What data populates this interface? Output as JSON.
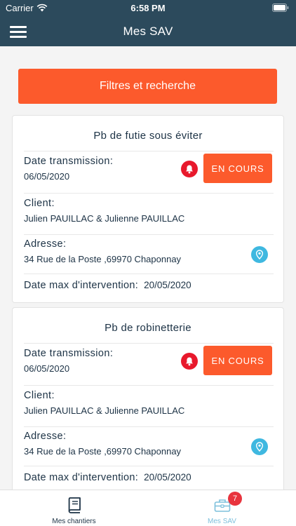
{
  "status_bar": {
    "carrier": "Carrier",
    "time": "6:58 PM"
  },
  "header": {
    "title": "Mes SAV"
  },
  "filter_button_label": "Filtres et recherche",
  "cards": [
    {
      "title": "Pb de futie sous éviter",
      "transmission_label": "Date transmission:",
      "transmission_date": "06/05/2020",
      "status": "EN COURS",
      "client_label": "Client:",
      "client": "Julien PAUILLAC & Julienne PAUILLAC",
      "address_label": "Adresse:",
      "address": "34 Rue de la Poste ,69970 Chaponnay",
      "date_max_label": "Date max d'intervention:",
      "date_max": "20/05/2020"
    },
    {
      "title": "Pb de robinetterie",
      "transmission_label": "Date transmission:",
      "transmission_date": "06/05/2020",
      "status": "EN COURS",
      "client_label": "Client:",
      "client": "Julien PAUILLAC & Julienne PAUILLAC",
      "address_label": "Adresse:",
      "address": "34 Rue de la Poste ,69970 Chaponnay",
      "date_max_label": "Date max d'intervention:",
      "date_max": "20/05/2020"
    }
  ],
  "tabs": [
    {
      "label": "Mes chantiers",
      "icon": "book-icon",
      "active": true
    },
    {
      "label": "Mes SAV",
      "icon": "toolbox-icon",
      "active": false,
      "badge": "7"
    }
  ],
  "colors": {
    "header": "#2c4a5c",
    "accent": "#fc5a2c",
    "alert": "#e8192c",
    "location": "#3fb8e0",
    "badge": "#e8343e"
  }
}
